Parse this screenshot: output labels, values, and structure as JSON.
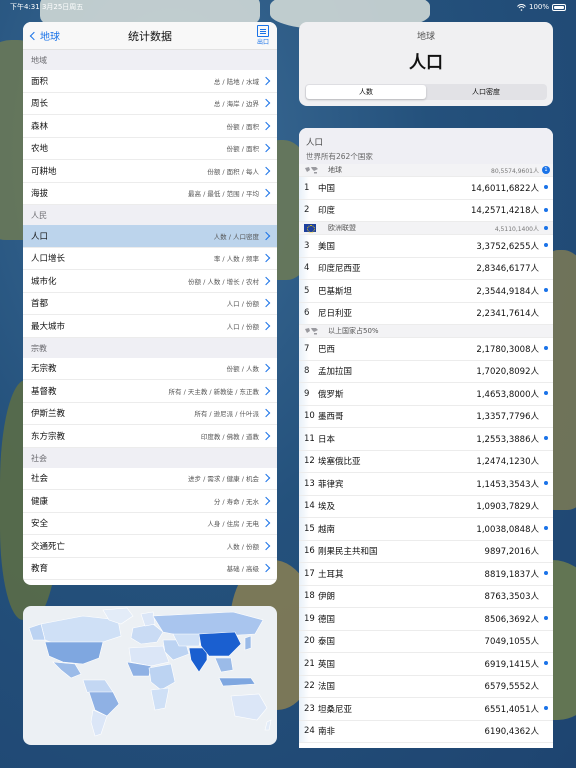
{
  "status_bar": {
    "left": "下午4:31 3月25日周五",
    "battery": "100%"
  },
  "left_panel": {
    "back_label": "地球",
    "title": "统计数据",
    "export_label": "出口",
    "sections": [
      {
        "header": "地域",
        "rows": [
          {
            "label": "面积",
            "detail": "总 / 陆地 / 水域"
          },
          {
            "label": "周长",
            "detail": "总 / 海岸 / 边界"
          },
          {
            "label": "森林",
            "detail": "份额 / 面积"
          },
          {
            "label": "农地",
            "detail": "份额 / 面积"
          },
          {
            "label": "可耕地",
            "detail": "份额 / 面积 / 每人"
          },
          {
            "label": "海拔",
            "detail": "最高 / 最低 / 范围 / 平均"
          }
        ]
      },
      {
        "header": "人民",
        "rows": [
          {
            "label": "人口",
            "detail": "人数 / 人口密度",
            "selected": true
          },
          {
            "label": "人口增长",
            "detail": "率 / 人数 / 频率"
          },
          {
            "label": "城市化",
            "detail": "份额 / 人数 / 增长 / 农村"
          },
          {
            "label": "首都",
            "detail": "人口 / 份额"
          },
          {
            "label": "最大城市",
            "detail": "人口 / 份额"
          }
        ]
      },
      {
        "header": "宗教",
        "rows": [
          {
            "label": "无宗教",
            "detail": "份额 / 人数"
          },
          {
            "label": "基督教",
            "detail": "所有 / 天主教 / 新教徒 / 东正教"
          },
          {
            "label": "伊斯兰教",
            "detail": "所有 / 逊尼派 / 什叶派"
          },
          {
            "label": "东方宗教",
            "detail": "印度教 / 佛教 / 道教"
          }
        ]
      },
      {
        "header": "社会",
        "rows": [
          {
            "label": "社会",
            "detail": "进步 / 需求 / 健康 / 机会"
          },
          {
            "label": "健康",
            "detail": "分 / 寿命 / 无水"
          },
          {
            "label": "安全",
            "detail": "人身 / 住房 / 无电"
          },
          {
            "label": "交通死亡",
            "detail": "人数 / 份额"
          },
          {
            "label": "教育",
            "detail": "基础 / 高级"
          }
        ]
      }
    ]
  },
  "header_card": {
    "subtitle": "地球",
    "title": "人口",
    "segments": [
      "人数",
      "人口密度"
    ]
  },
  "population": {
    "heading": "人口",
    "subheading": "世界所有262个国家",
    "world": {
      "label": "地球",
      "value": "80,5574,9601人"
    },
    "eu": {
      "label": "欧洲联盟",
      "value": "4,5110,1400人"
    },
    "half": {
      "label": "以上国家占50%"
    },
    "rows": [
      {
        "rank": "1",
        "name": "中国",
        "value": "14,6011,6822人"
      },
      {
        "rank": "2",
        "name": "印度",
        "value": "14,2571,4218人"
      },
      {
        "rank": "3",
        "name": "美国",
        "value": "3,3752,6255人"
      },
      {
        "rank": "4",
        "name": "印度尼西亚",
        "value": "2,8346,6177人"
      },
      {
        "rank": "5",
        "name": "巴基斯坦",
        "value": "2,3544,9184人"
      },
      {
        "rank": "6",
        "name": "尼日利亚",
        "value": "2,2341,7614人"
      },
      {
        "rank": "7",
        "name": "巴西",
        "value": "2,1780,3008人"
      },
      {
        "rank": "8",
        "name": "孟加拉国",
        "value": "1,7020,8092人"
      },
      {
        "rank": "9",
        "name": "俄罗斯",
        "value": "1,4653,8000人"
      },
      {
        "rank": "10",
        "name": "墨西哥",
        "value": "1,3357,7796人"
      },
      {
        "rank": "11",
        "name": "日本",
        "value": "1,2553,3886人"
      },
      {
        "rank": "12",
        "name": "埃塞俄比亚",
        "value": "1,2474,1230人"
      },
      {
        "rank": "13",
        "name": "菲律宾",
        "value": "1,1453,3543人"
      },
      {
        "rank": "14",
        "name": "埃及",
        "value": "1,0903,7829人"
      },
      {
        "rank": "15",
        "name": "越南",
        "value": "1,0038,0848人"
      },
      {
        "rank": "16",
        "name": "刚果民主共和国",
        "value": "9897,2016人"
      },
      {
        "rank": "17",
        "name": "土耳其",
        "value": "8819,1837人"
      },
      {
        "rank": "18",
        "name": "伊朗",
        "value": "8763,3503人"
      },
      {
        "rank": "19",
        "name": "德国",
        "value": "8506,3692人"
      },
      {
        "rank": "20",
        "name": "泰国",
        "value": "7049,1055人"
      },
      {
        "rank": "21",
        "name": "英国",
        "value": "6919,1415人"
      },
      {
        "rank": "22",
        "name": "法国",
        "value": "6579,5552人"
      },
      {
        "rank": "23",
        "name": "坦桑尼亚",
        "value": "6551,4051人"
      },
      {
        "rank": "24",
        "name": "南非",
        "value": "6190,4362人"
      }
    ],
    "badge": "1"
  },
  "colors": {
    "accent": "#1a73e8",
    "selected_row": "#bcd4ec",
    "map_highlight": "#1a5fd0",
    "map_shade": "#7fa7e0"
  }
}
